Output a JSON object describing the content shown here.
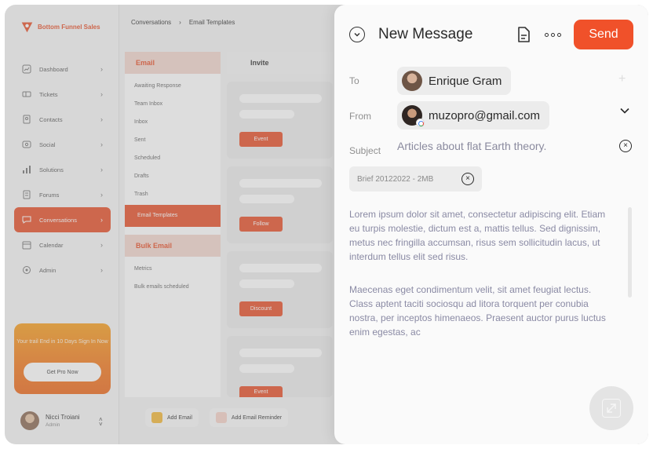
{
  "brand": {
    "name": "Bottom Funnel Sales",
    "color": "#e8512b"
  },
  "sidebar": {
    "items": [
      {
        "label": "Dashboard",
        "icon": "chart-icon"
      },
      {
        "label": "Tickets",
        "icon": "ticket-icon"
      },
      {
        "label": "Contacts",
        "icon": "contacts-icon"
      },
      {
        "label": "Social",
        "icon": "social-icon"
      },
      {
        "label": "Solutions",
        "icon": "solutions-icon"
      },
      {
        "label": "Forums",
        "icon": "forums-icon"
      },
      {
        "label": "Conversations",
        "icon": "chat-icon",
        "active": true
      },
      {
        "label": "Calendar",
        "icon": "calendar-icon"
      },
      {
        "label": "Admin",
        "icon": "admin-icon"
      }
    ],
    "trial": {
      "text": "Your trail End in 10 Days Sign In Now",
      "button": "Get Pro Now"
    },
    "user": {
      "name": "Nicci Troiani",
      "role": "Admin"
    }
  },
  "breadcrumb": [
    "Conversations",
    "Email Templates"
  ],
  "email_section": {
    "title": "Email",
    "items": [
      "Awaiting Response",
      "Team Inbox",
      "Inbox",
      "Sent",
      "Scheduled",
      "Drafts",
      "Trash",
      "Email Templates"
    ],
    "active": "Email Templates"
  },
  "bulk_section": {
    "title": "Bulk Email",
    "items": [
      "Metrics",
      "Bulk emails scheduled"
    ]
  },
  "templates": {
    "header": "Invite",
    "cards": [
      {
        "button": "Event"
      },
      {
        "button": "Follow"
      },
      {
        "button": "Discount"
      },
      {
        "button": "Event"
      }
    ]
  },
  "bottom_bar": {
    "add_email": "Add Email",
    "add_reminder": "Add Email Reminder"
  },
  "modal": {
    "title": "New Message",
    "send_label": "Send",
    "to_label": "To",
    "to_name": "Enrique Gram",
    "from_label": "From",
    "from_email": "muzopro@gmail.com",
    "subject_label": "Subject",
    "subject_value": "Articles about flat Earth theory.",
    "attachment": "Brief 20122022 - 2MB",
    "body": [
      "Lorem ipsum dolor sit amet, consectetur adipiscing elit. Etiam eu turpis molestie, dictum est a, mattis tellus. Sed dignissim, metus nec fringilla accumsan, risus sem sollicitudin lacus, ut interdum tellus elit sed risus.",
      "Maecenas eget condimentum velit, sit amet feugiat lectus. Class aptent taciti sociosqu ad litora torquent per conubia nostra, per inceptos himenaeos. Praesent auctor purus luctus enim egestas, ac"
    ],
    "accent": "#f0512a"
  }
}
